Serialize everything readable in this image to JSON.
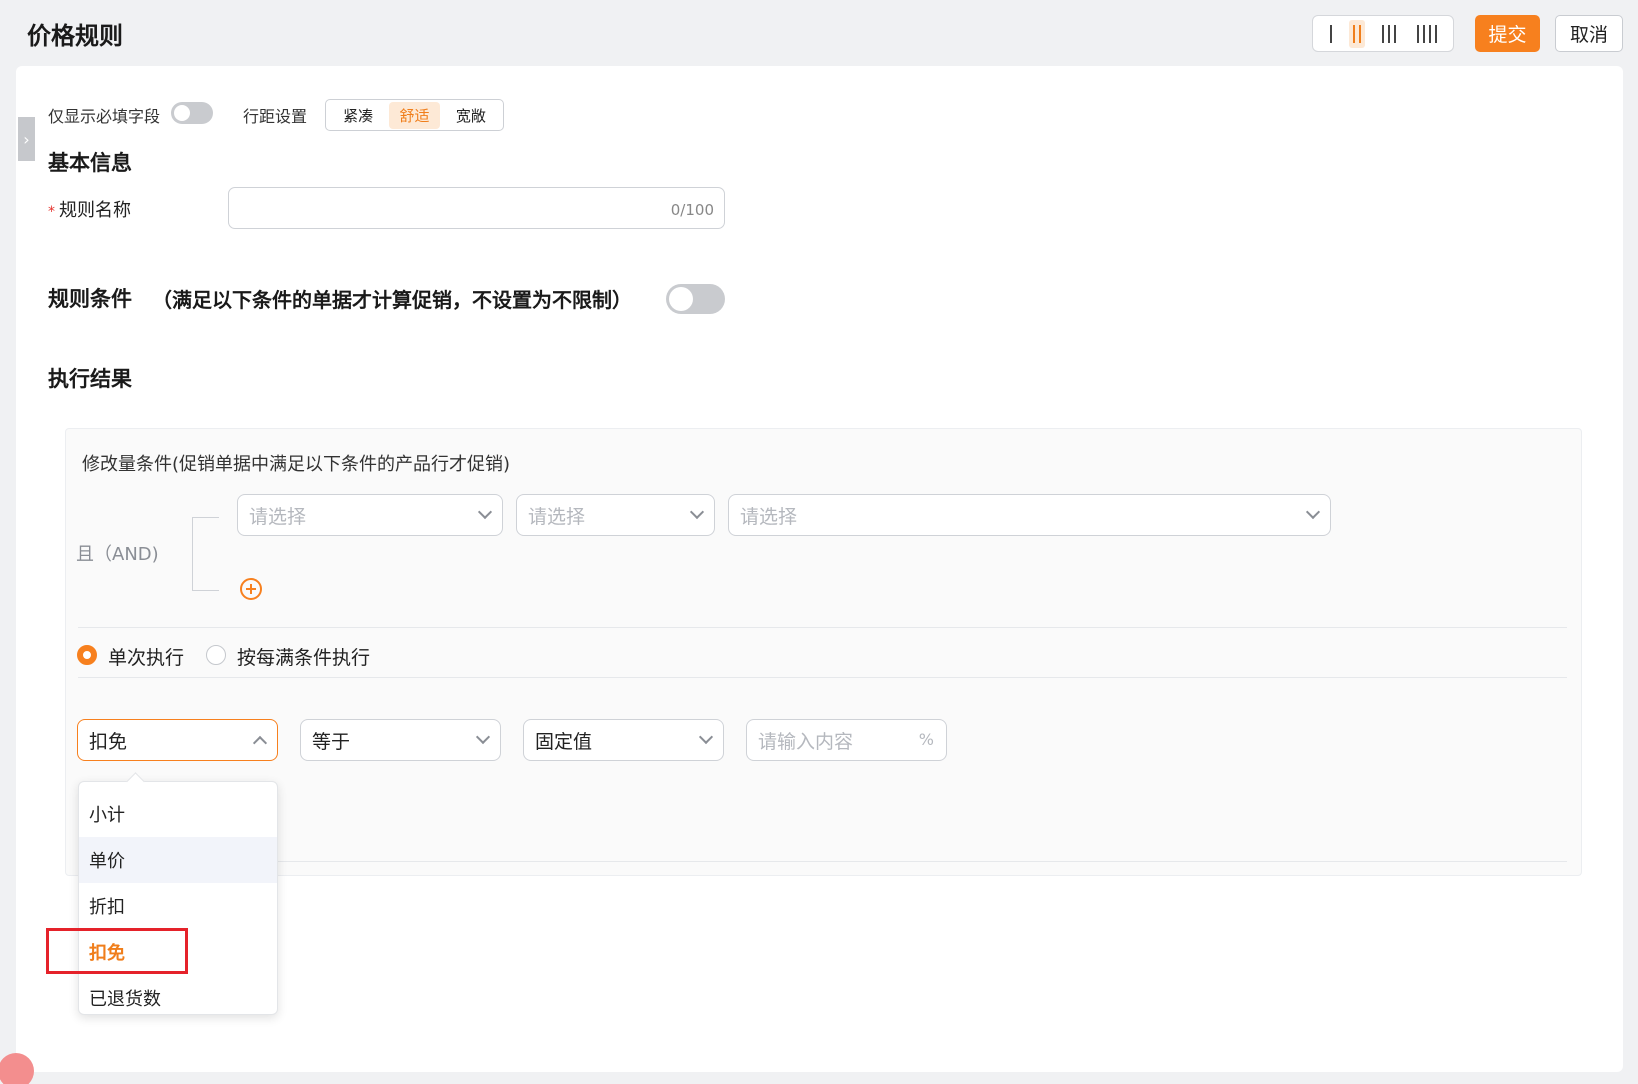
{
  "header": {
    "title": "价格规则",
    "density_options": [
      "single",
      "double",
      "triple",
      "quad"
    ],
    "active_density": "double",
    "submit_label": "提交",
    "cancel_label": "取消"
  },
  "colors": {
    "accent": "#f7801e",
    "highlight": "#e5222a"
  },
  "toolbar": {
    "required_only_label": "仅显示必填字段",
    "row_spacing_label": "行距设置",
    "spacing_options": [
      "紧凑",
      "舒适",
      "宽敞"
    ],
    "active_spacing": "舒适"
  },
  "basic_info": {
    "title": "基本信息",
    "rule_name_label": "规则名称",
    "rule_name_required": "*",
    "rule_name_value": "",
    "rule_name_counter": "0/100"
  },
  "conditions": {
    "title": "规则条件",
    "subtitle": "（满足以下条件的单据才计算促销，不设置为不限制）"
  },
  "result": {
    "title": "执行结果",
    "panel_title": "修改量条件(促销单据中满足以下条件的产品行才促销)",
    "and_label": "且（AND)",
    "select_placeholder": "请选择",
    "radio_single": "单次执行",
    "radio_each": "按每满条件执行",
    "field_value": "扣免",
    "operator_value": "等于",
    "type_value": "固定值",
    "content_placeholder": "请输入内容",
    "content_unit": "%"
  },
  "dropdown": {
    "items": [
      "小计",
      "单价",
      "折扣",
      "扣免",
      "已退货数"
    ],
    "hovered": "单价",
    "selected": "扣免"
  }
}
